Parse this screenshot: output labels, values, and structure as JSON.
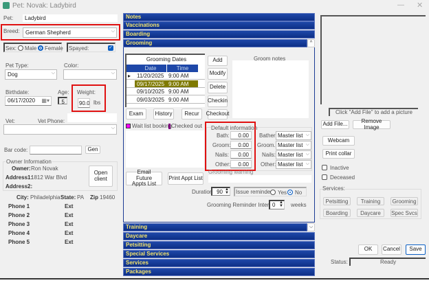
{
  "window": {
    "title": "Pet: Novak: Ladybird"
  },
  "pet": {
    "pet_label": "Pet:",
    "pet_value": "Ladybird",
    "breed_label": "Breed:",
    "breed_value": "German Shepherd",
    "sex_label": "Sex:",
    "sex_male": "Male",
    "sex_female": "Female",
    "sex_selected": "Female",
    "spayed_label": "Spayed:",
    "spayed_checked": true,
    "pet_type_label": "Pet Type:",
    "pet_type_value": "Dog",
    "color_label": "Color:",
    "color_value": "",
    "birthdate_label": "Birthdate:",
    "birthdate_value": "06/17/2020",
    "age_label": "Age:",
    "age_value": "5",
    "weight_label": "Weight:",
    "weight_value": "90.0",
    "weight_unit": "lbs",
    "vet_label": "Vet:",
    "vet_phone_label": "Vet Phone:",
    "barcode_label": "Bar code:",
    "gen_button": "Gen"
  },
  "owner": {
    "group_label": "Owner Information",
    "owner_label": "Owner:",
    "owner_value": "Ron Novak",
    "address1_label": "Address1:",
    "address1_value": "1812 War Blvd",
    "address2_label": "Address2:",
    "open_client": "Open client",
    "city_label": "City:",
    "city_value": "Philadelphia",
    "state_label": "State:",
    "state_value": "PA",
    "zip_label": "Zip",
    "zip_value": "19460",
    "phones": [
      {
        "label": "Phone 1",
        "ext": "Ext"
      },
      {
        "label": "Phone 2",
        "ext": "Ext"
      },
      {
        "label": "Phone 3",
        "ext": "Ext"
      },
      {
        "label": "Phone 4",
        "ext": "Ext"
      },
      {
        "label": "Phone 5",
        "ext": "Ext"
      }
    ]
  },
  "sections_top": [
    "Notes",
    "Vaccinations",
    "Boarding",
    "Grooming"
  ],
  "sections_bottom": [
    "Training",
    "Daycare",
    "Petsitting",
    "Special Services",
    "Services",
    "Packages"
  ],
  "grooming": {
    "dates_title": "Grooming Dates",
    "col_date": "Date",
    "col_time": "Time",
    "rows": [
      {
        "date": "11/20/2025",
        "time": "9:00 AM",
        "current": true
      },
      {
        "date": "09/17/2025",
        "time": "9:00 AM",
        "selected": true
      },
      {
        "date": "09/10/2025",
        "time": "9:00 AM"
      },
      {
        "date": "09/03/2025",
        "time": "9:00 AM"
      }
    ],
    "buttons": {
      "add": "Add",
      "modify": "Modify",
      "delete": "Delete",
      "checkin": "Checkin",
      "checkout": "Checkout",
      "exam": "Exam",
      "history": "History",
      "recur": "Recur",
      "email": "Email Future Appts List",
      "print": "Print Appt List"
    },
    "notes_label": "Groom notes",
    "legend_waitlist": "Wait list booking",
    "legend_checked": "Checked out",
    "waitlist_color": "#ff00ff",
    "checked_color": "#800080",
    "default_info": {
      "label": "Default information",
      "items": [
        {
          "label": "Bath:",
          "value": "0.00",
          "staff_label": "Bather:",
          "staff": "Master list"
        },
        {
          "label": "Groom:",
          "value": "0.00",
          "staff_label": "Groom...",
          "staff": "Master list"
        },
        {
          "label": "Nails:",
          "value": "0.00",
          "staff_label": "Nails:",
          "staff": "Master list"
        },
        {
          "label": "Other:",
          "value": "0.00",
          "staff_label": "Other:",
          "staff": "Master list"
        }
      ]
    },
    "warning_label": "Grooming warning",
    "duration_label": "Duration:",
    "duration_value": "90",
    "reminders_label": "Issue reminders",
    "yes": "Yes",
    "no": "No",
    "reminders_selected": "No",
    "interval_label": "Grooming Reminder Interval:",
    "interval_value": "0",
    "interval_unit": "weeks"
  },
  "picture": {
    "caption": "Click \"Add File\" to add a picture",
    "add_file": "Add File...",
    "remove_image": "Remove Image",
    "webcam": "Webcam",
    "print_collar": "Print collar",
    "inactive": "Inactive",
    "deceased": "Deceased"
  },
  "services": {
    "label": "Services:",
    "buttons": [
      "Petsitting",
      "Training",
      "Grooming",
      "Boarding",
      "Daycare",
      "Spec Svcs"
    ]
  },
  "footer": {
    "ok": "OK",
    "cancel": "Cancel",
    "save": "Save",
    "status_label": "Status:",
    "status_value": "Ready"
  }
}
